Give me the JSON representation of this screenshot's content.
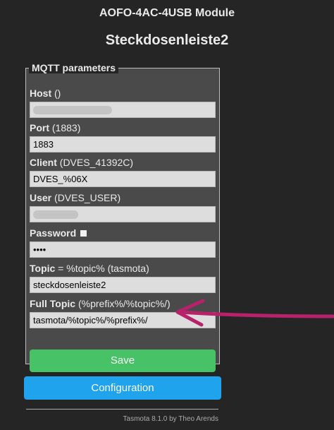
{
  "header": {
    "module": "AOFO-4AC-4USB Module",
    "device": "Steckdosenleiste2"
  },
  "mqtt": {
    "legend": "MQTT parameters",
    "host": {
      "label": "Host",
      "hint": " ()",
      "value": ""
    },
    "port": {
      "label": "Port",
      "hint": " (1883)",
      "value": "1883"
    },
    "client": {
      "label": "Client",
      "hint": " (DVES_41392C)",
      "value": "DVES_%06X"
    },
    "user": {
      "label": "User",
      "hint": " (DVES_USER)",
      "value": ""
    },
    "password": {
      "label": "Password",
      "value": "••••"
    },
    "topic": {
      "label": "Topic",
      "hint": " = %topic% (tasmota)",
      "value": "steckdosenleiste2"
    },
    "full_topic": {
      "label": "Full Topic",
      "hint": " (%prefix%/%topic%/)",
      "value": "tasmota/%topic%/%prefix%/"
    },
    "save_label": "Save"
  },
  "config_label": "Configuration",
  "footer": "Tasmota 8.1.0 by Theo Arends",
  "colors": {
    "background": "#252525",
    "panel": "#4a4a4a",
    "save": "#47c266",
    "config": "#1fa3ec",
    "annotation_arrow": "#b8226a"
  }
}
